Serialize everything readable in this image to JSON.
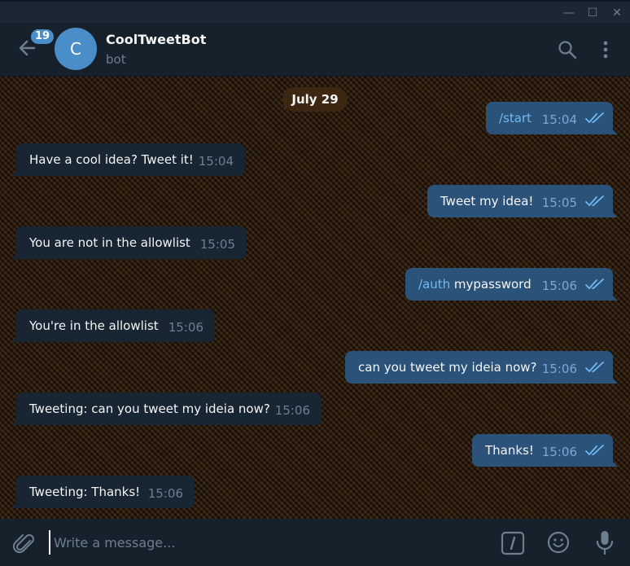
{
  "window": {
    "minimize_glyph": "—",
    "maximize_glyph": "☐",
    "close_glyph": "✕"
  },
  "header": {
    "back_icon": "back-arrow-icon",
    "unread_count": "19",
    "avatar_letter": "C",
    "chat_name": "CoolTweetBot",
    "chat_status": "bot",
    "search_icon": "search-icon",
    "more_icon": "more-vertical-icon"
  },
  "chat": {
    "date": "July 29",
    "messages": [
      {
        "direction": "out",
        "command": "/start",
        "text": "",
        "time": "15:04",
        "status": "read"
      },
      {
        "direction": "in",
        "text": "Have a cool idea? Tweet it!",
        "time": "15:04"
      },
      {
        "direction": "out",
        "command": "",
        "text": "Tweet my idea!",
        "time": "15:05",
        "status": "read"
      },
      {
        "direction": "in",
        "text": "You are not in the allowlist",
        "time": "15:05"
      },
      {
        "direction": "out",
        "command": "/auth",
        "text": " mypassword",
        "time": "15:06",
        "status": "read"
      },
      {
        "direction": "in",
        "text": "You're in the allowlist",
        "time": "15:06"
      },
      {
        "direction": "out",
        "command": "",
        "text": "can you tweet my ideia now?",
        "time": "15:06",
        "status": "read"
      },
      {
        "direction": "in",
        "text": "Tweeting: can you tweet my ideia now?",
        "time": "15:06"
      },
      {
        "direction": "out",
        "command": "",
        "text": "Thanks!",
        "time": "15:06",
        "status": "read"
      },
      {
        "direction": "in",
        "text": "Tweeting: Thanks!",
        "time": "15:06"
      }
    ]
  },
  "composer": {
    "placeholder": "Write a message...",
    "value": "",
    "attach_icon": "paperclip-icon",
    "commands_icon": "bot-commands-icon",
    "emoji_icon": "emoji-icon",
    "mic_icon": "microphone-icon"
  },
  "colors": {
    "background": "#17212b",
    "incoming_bubble": "#182533",
    "outgoing_bubble": "#2b5278",
    "accent": "#4a8ec9",
    "command_link": "#71b9f4",
    "date_pill": "#3d2612"
  }
}
